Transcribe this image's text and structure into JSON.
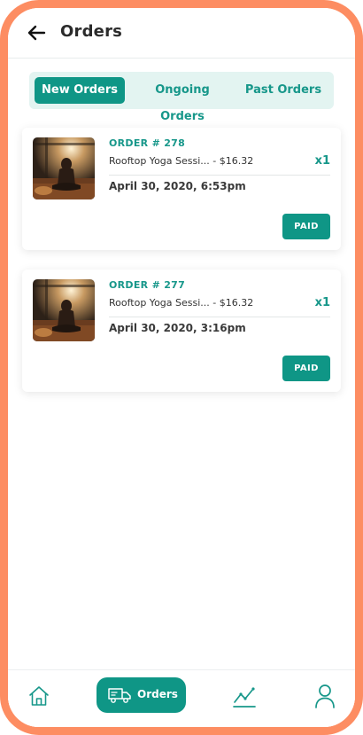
{
  "header": {
    "title": "Orders",
    "back_icon": "arrow-left-icon"
  },
  "tabs": [
    {
      "label": "New Orders",
      "active": true
    },
    {
      "label": "Ongoing Orders",
      "active": false
    },
    {
      "label": "Past Orders",
      "active": false
    }
  ],
  "orders": [
    {
      "number": "ORDER # 278",
      "item": "Rooftop Yoga Sessi...",
      "price": " - $16.32",
      "qty": "x1",
      "date": "April 30, 2020, 6:53pm",
      "status": "PAID"
    },
    {
      "number": "ORDER # 277",
      "item": "Rooftop Yoga Sessi...",
      "price": " - $16.32",
      "qty": "x1",
      "date": "April 30, 2020, 3:16pm",
      "status": "PAID"
    }
  ],
  "bottom_nav": {
    "home_icon": "home-icon",
    "orders_label": "Orders",
    "orders_icon": "truck-icon",
    "stats_icon": "chart-line-icon",
    "profile_icon": "user-icon"
  },
  "colors": {
    "accent": "#0f9686",
    "accent_light": "#e3f4f1",
    "frame": "#fd8d62"
  }
}
